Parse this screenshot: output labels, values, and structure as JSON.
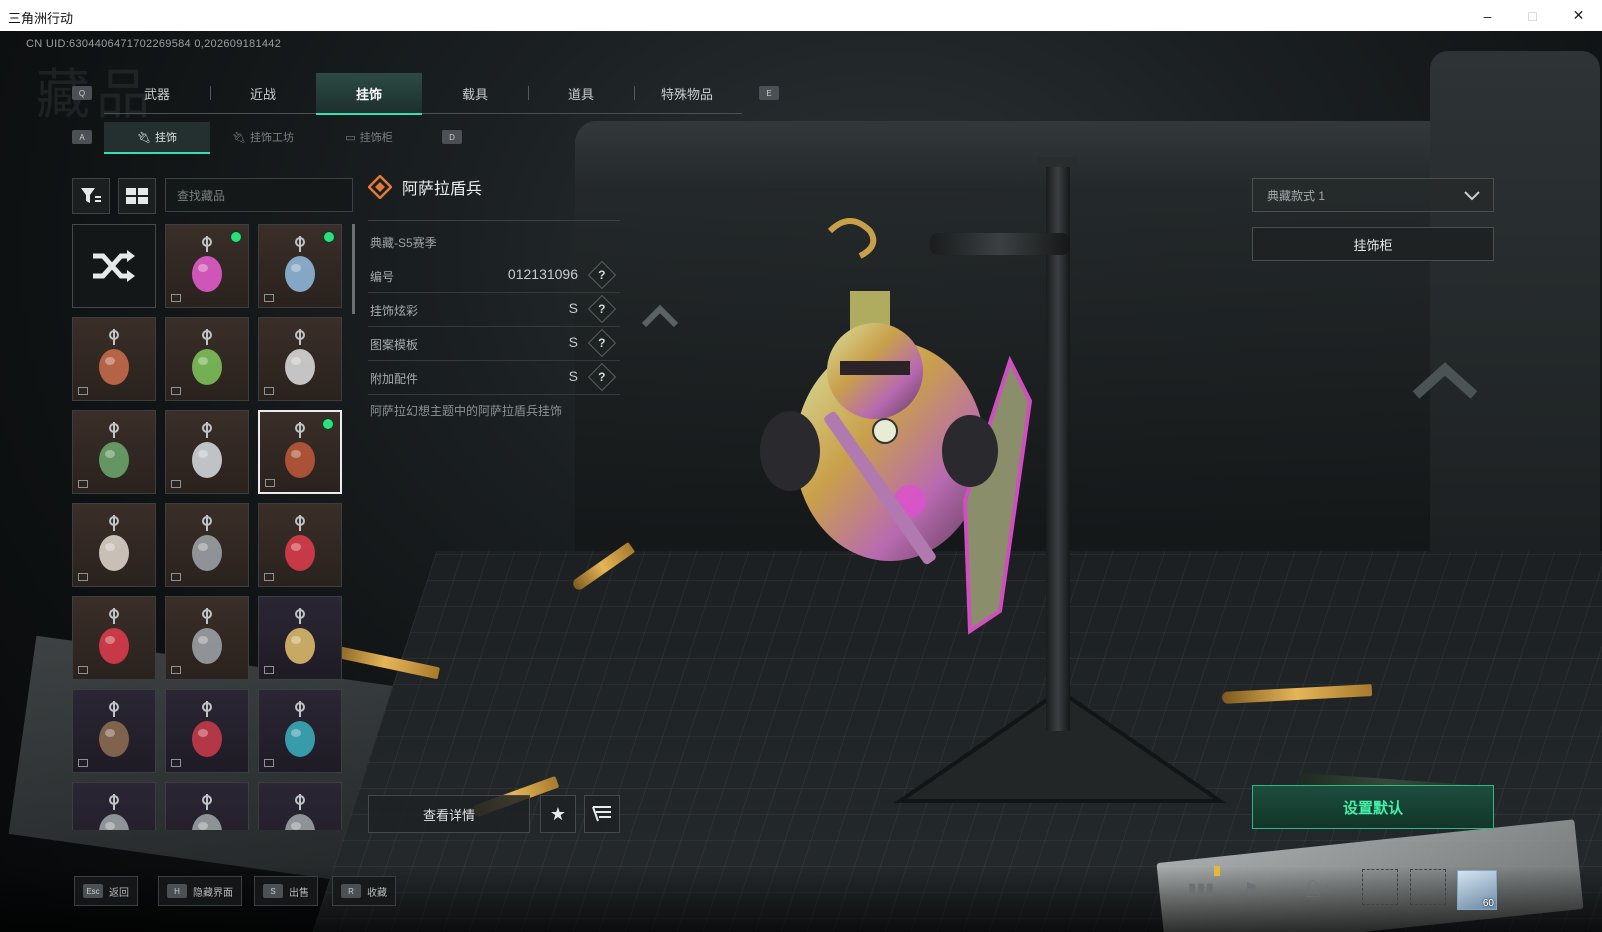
{
  "window": {
    "title": "三角洲行动",
    "minimize": "–",
    "maximize": "□",
    "close": "✕"
  },
  "uid_text": "CN UID:6304406471702269584 0,202609181442",
  "watermark": "藏品",
  "main_tabs": {
    "key_left": "Q",
    "key_right": "E",
    "items": [
      {
        "label": "武器",
        "active": false
      },
      {
        "label": "近战",
        "active": false
      },
      {
        "label": "挂饰",
        "active": true
      },
      {
        "label": "载具",
        "active": false
      },
      {
        "label": "道具",
        "active": false
      },
      {
        "label": "特殊物品",
        "active": false
      }
    ]
  },
  "sub_tabs": {
    "key_left": "A",
    "key_right": "D",
    "items": [
      {
        "label": "挂饰",
        "icon": "charm-icon",
        "active": true
      },
      {
        "label": "挂饰工坊",
        "icon": "charm-icon",
        "active": false
      },
      {
        "label": "挂饰柜",
        "icon": "cabinet-icon",
        "active": false
      }
    ]
  },
  "search": {
    "placeholder": "查找藏品"
  },
  "grid": {
    "items": [
      {
        "name": "random-charm",
        "kind": "random",
        "new": false
      },
      {
        "name": "charm-pink-trinket",
        "kind": "charm",
        "new": true
      },
      {
        "name": "charm-card-tag",
        "kind": "charm",
        "new": true
      },
      {
        "name": "charm-red-creature",
        "kind": "charm",
        "new": false
      },
      {
        "name": "charm-green-plant",
        "kind": "charm",
        "new": false
      },
      {
        "name": "charm-armored-dog",
        "kind": "charm",
        "new": false
      },
      {
        "name": "charm-green-mech",
        "kind": "charm",
        "new": false
      },
      {
        "name": "charm-shark",
        "kind": "charm",
        "new": false
      },
      {
        "name": "charm-shield-soldier",
        "kind": "charm",
        "new": true,
        "selected": true
      },
      {
        "name": "charm-feather",
        "kind": "charm",
        "new": false
      },
      {
        "name": "charm-silver-ring",
        "kind": "charm",
        "new": false
      },
      {
        "name": "charm-lighter-red",
        "kind": "charm",
        "new": false
      },
      {
        "name": "charm-lighter-red-2",
        "kind": "charm",
        "new": false
      },
      {
        "name": "charm-disco-ball",
        "kind": "charm",
        "new": false
      },
      {
        "name": "charm-skull-gold",
        "kind": "charm",
        "new": false,
        "purple": true
      },
      {
        "name": "charm-tarot-card",
        "kind": "charm",
        "new": false,
        "purple": true
      },
      {
        "name": "charm-red-gem",
        "kind": "charm",
        "new": false,
        "purple": true
      },
      {
        "name": "charm-teal-box",
        "kind": "charm",
        "new": false,
        "purple": true
      },
      {
        "name": "charm-ring-a",
        "kind": "charm",
        "new": false,
        "purple": true
      },
      {
        "name": "charm-ring-b",
        "kind": "charm",
        "new": false,
        "purple": true
      },
      {
        "name": "charm-ring-c",
        "kind": "charm",
        "new": false,
        "purple": true
      }
    ]
  },
  "detail": {
    "title": "阿萨拉盾兵",
    "season": "典藏-S5赛季",
    "rows": [
      {
        "label": "编号",
        "value": "012131096"
      },
      {
        "label": "挂饰炫彩",
        "value": "S"
      },
      {
        "label": "图案模板",
        "value": "S"
      },
      {
        "label": "附加配件",
        "value": "S"
      }
    ],
    "help_symbol": "?",
    "description": "阿萨拉幻想主题中的阿萨拉盾兵挂饰",
    "view_details_label": "查看详情",
    "favorite_symbol": "★",
    "wishlist_symbol": "☰"
  },
  "right_panel": {
    "style_select_value": "典藏款式 1",
    "cabinet_button_label": "挂饰柜",
    "set_default_label": "设置默认"
  },
  "bottom_hints": [
    {
      "key": "Esc",
      "label": "返回"
    },
    {
      "key": "H",
      "label": "隐藏界面"
    },
    {
      "key": "S",
      "label": "出售"
    },
    {
      "key": "R",
      "label": "收藏"
    }
  ],
  "status": {
    "player_count": "4",
    "level": "60"
  },
  "colors": {
    "accent": "#35e0b0",
    "new_dot": "#2de07c",
    "default_btn_text": "#43f0a8"
  }
}
